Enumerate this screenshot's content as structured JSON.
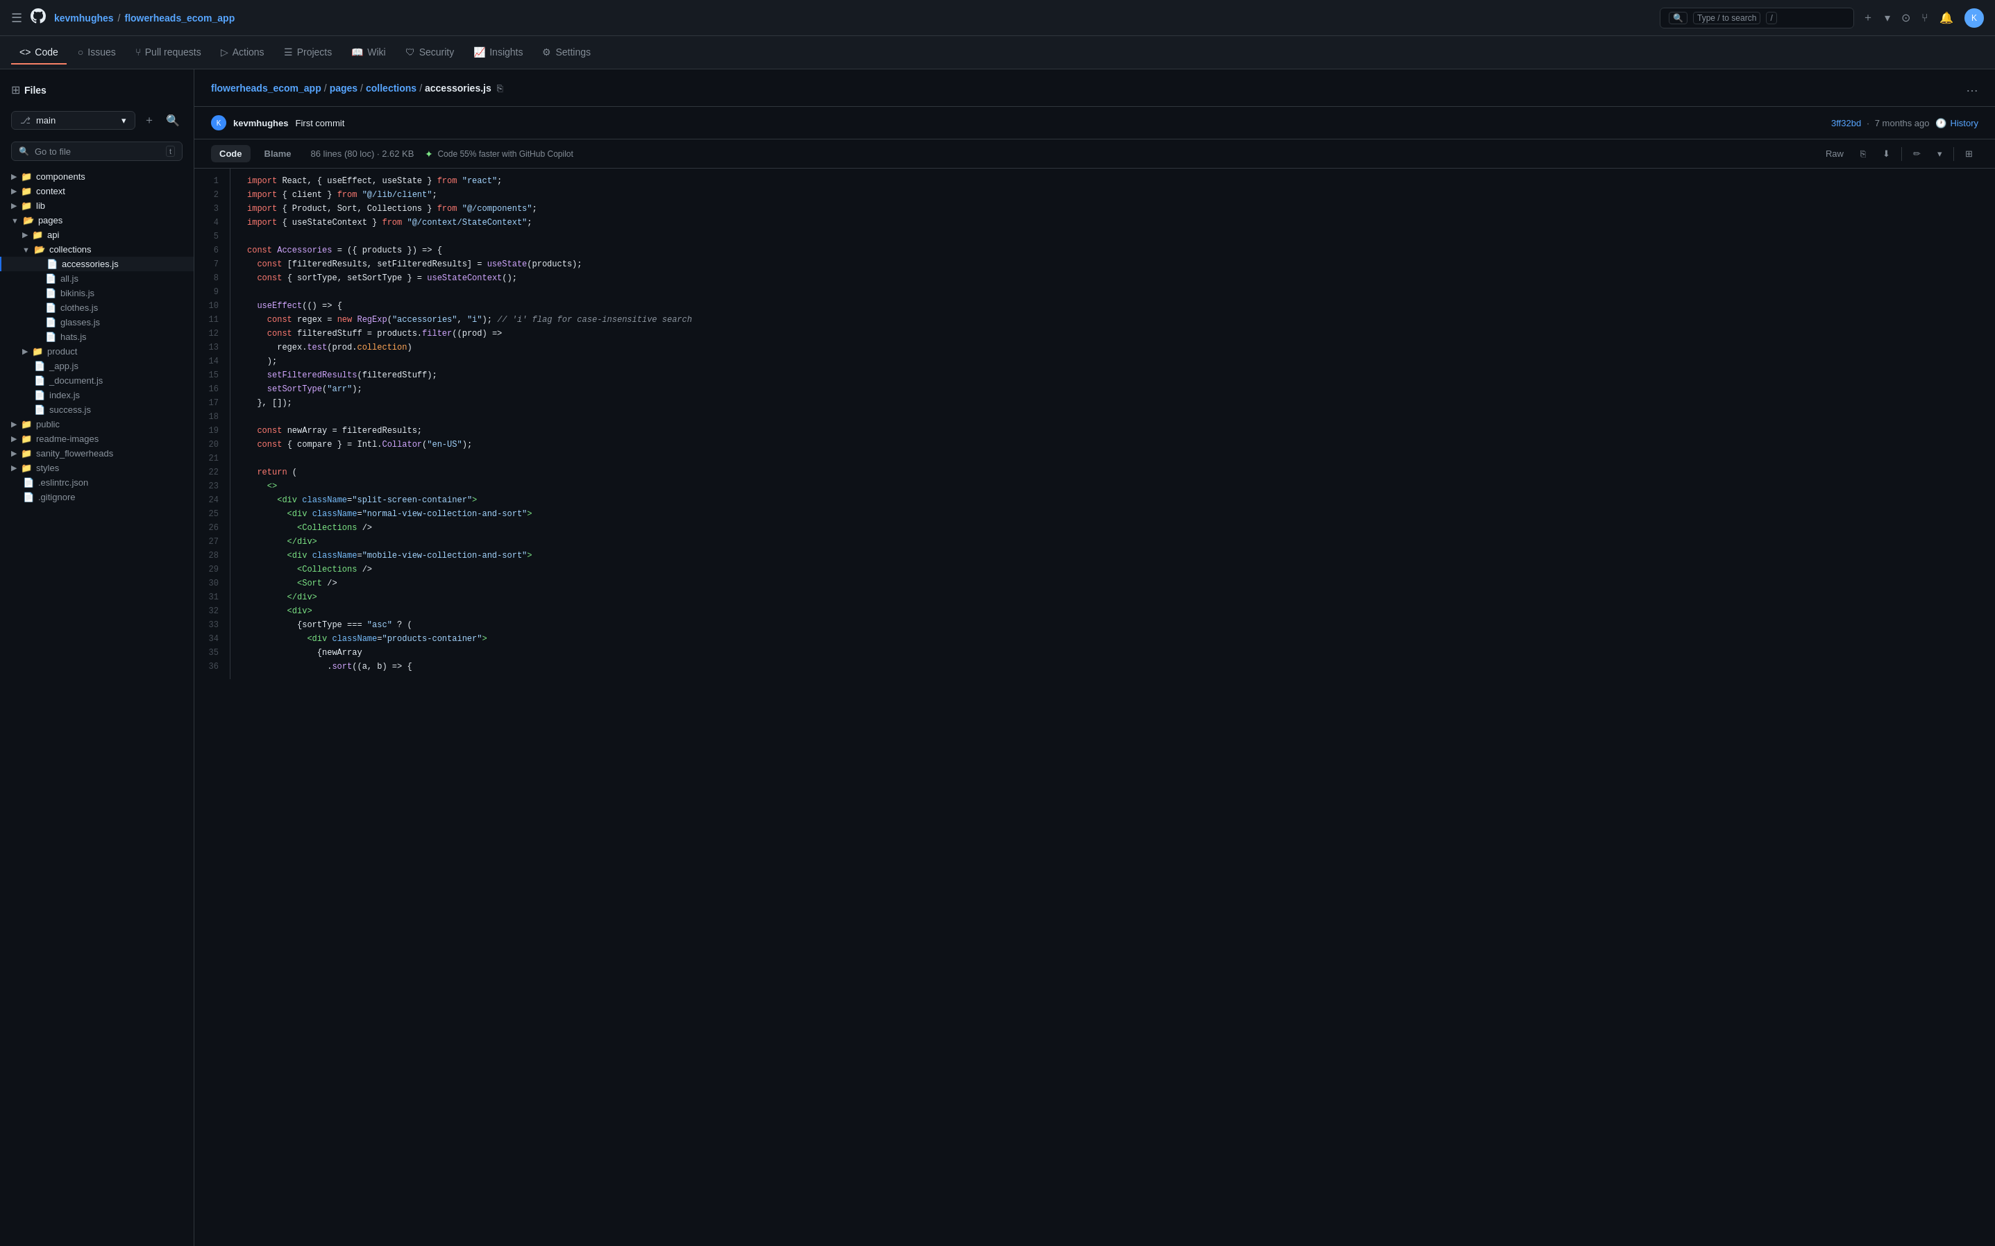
{
  "topNav": {
    "username": "kevmhughes",
    "separator": "/",
    "repo": "flowerheads_ecom_app",
    "search_placeholder": "Type / to search",
    "plus_icon": "+",
    "avatar_initials": "K"
  },
  "repoNav": {
    "items": [
      {
        "id": "code",
        "label": "Code",
        "icon": "<>",
        "active": true
      },
      {
        "id": "issues",
        "label": "Issues",
        "icon": "○"
      },
      {
        "id": "pull-requests",
        "label": "Pull requests",
        "icon": "⑂"
      },
      {
        "id": "actions",
        "label": "Actions",
        "icon": "▷"
      },
      {
        "id": "projects",
        "label": "Projects",
        "icon": "☰"
      },
      {
        "id": "wiki",
        "label": "Wiki",
        "icon": "📖"
      },
      {
        "id": "security",
        "label": "Security",
        "icon": "🛡"
      },
      {
        "id": "insights",
        "label": "Insights",
        "icon": "📈"
      },
      {
        "id": "settings",
        "label": "Settings",
        "icon": "⚙"
      }
    ]
  },
  "sidebar": {
    "files_label": "Files",
    "branch": "main",
    "go_to_file": "Go to file",
    "go_to_file_shortcut": "t",
    "tree": [
      {
        "id": "components",
        "type": "folder",
        "label": "components",
        "indent": 0,
        "collapsed": true
      },
      {
        "id": "context",
        "type": "folder",
        "label": "context",
        "indent": 0,
        "collapsed": true
      },
      {
        "id": "lib",
        "type": "folder",
        "label": "lib",
        "indent": 0,
        "collapsed": true
      },
      {
        "id": "pages",
        "type": "folder",
        "label": "pages",
        "indent": 0,
        "collapsed": false
      },
      {
        "id": "api",
        "type": "folder",
        "label": "api",
        "indent": 1,
        "collapsed": true
      },
      {
        "id": "collections",
        "type": "folder",
        "label": "collections",
        "indent": 1,
        "collapsed": false
      },
      {
        "id": "accessories-js",
        "type": "file",
        "label": "accessories.js",
        "indent": 2,
        "active": true
      },
      {
        "id": "all-js",
        "type": "file",
        "label": "all.js",
        "indent": 2
      },
      {
        "id": "bikinis-js",
        "type": "file",
        "label": "bikinis.js",
        "indent": 2
      },
      {
        "id": "clothes-js",
        "type": "file",
        "label": "clothes.js",
        "indent": 2
      },
      {
        "id": "glasses-js",
        "type": "file",
        "label": "glasses.js",
        "indent": 2
      },
      {
        "id": "hats-js",
        "type": "file",
        "label": "hats.js",
        "indent": 2
      },
      {
        "id": "product",
        "type": "folder",
        "label": "product",
        "indent": 1,
        "collapsed": true
      },
      {
        "id": "_app-js",
        "type": "file",
        "label": "_app.js",
        "indent": 1
      },
      {
        "id": "_document-js",
        "type": "file",
        "label": "_document.js",
        "indent": 1
      },
      {
        "id": "index-js",
        "type": "file",
        "label": "index.js",
        "indent": 1
      },
      {
        "id": "success-js",
        "type": "file",
        "label": "success.js",
        "indent": 1
      },
      {
        "id": "public",
        "type": "folder",
        "label": "public",
        "indent": 0,
        "collapsed": true
      },
      {
        "id": "readme-images",
        "type": "folder",
        "label": "readme-images",
        "indent": 0,
        "collapsed": true
      },
      {
        "id": "sanity-flowerheads",
        "type": "folder",
        "label": "sanity_flowerheads",
        "indent": 0,
        "collapsed": true
      },
      {
        "id": "styles",
        "type": "folder",
        "label": "styles",
        "indent": 0,
        "collapsed": true
      },
      {
        "id": "eslintrc-json",
        "type": "file",
        "label": ".eslintrc.json",
        "indent": 0
      },
      {
        "id": "gitignore",
        "type": "file",
        "label": ".gitignore",
        "indent": 0
      }
    ]
  },
  "breadcrumb": {
    "parts": [
      {
        "label": "flowerheads_ecom_app",
        "link": true
      },
      {
        "label": "pages",
        "link": true
      },
      {
        "label": "collections",
        "link": true
      },
      {
        "label": "accessories.js",
        "link": false
      }
    ]
  },
  "fileMeta": {
    "author_initials": "K",
    "author": "kevmhughes",
    "message": "First commit",
    "hash": "3ff32bd",
    "age": "7 months ago",
    "history_label": "History"
  },
  "fileActions": {
    "code_label": "Code",
    "blame_label": "Blame",
    "lines": "86 lines (80 loc)",
    "size": "2.62 KB",
    "copilot": "Code 55% faster with GitHub Copilot",
    "raw": "Raw"
  },
  "codeLines": [
    {
      "n": 1,
      "html": "<span class='import-kw'>import</span> <span class='plain'>React, { useEffect, useState } </span><span class='import-kw'>from</span> <span class='str'>\"react\"</span><span class='plain'>;</span>"
    },
    {
      "n": 2,
      "html": "<span class='import-kw'>import</span> <span class='plain'>{ client } </span><span class='import-kw'>from</span> <span class='str'>\"@/lib/client\"</span><span class='plain'>;</span>"
    },
    {
      "n": 3,
      "html": "<span class='import-kw'>import</span> <span class='plain'>{ Product, Sort, Collections } </span><span class='import-kw'>from</span> <span class='str'>\"@/components\"</span><span class='plain'>;</span>"
    },
    {
      "n": 4,
      "html": "<span class='import-kw'>import</span> <span class='plain'>{ useStateContext } </span><span class='import-kw'>from</span> <span class='str'>\"@/context/StateContext\"</span><span class='plain'>;</span>"
    },
    {
      "n": 5,
      "html": ""
    },
    {
      "n": 6,
      "html": "<span class='kw'>const</span> <span class='fn'>Accessories</span> <span class='plain'>= ({ products }) =&gt; {</span>",
      "expand": true
    },
    {
      "n": 7,
      "html": "<span class='plain'>  </span><span class='kw'>const</span> <span class='plain'>[filteredResults, setFilteredResults] = </span><span class='fn'>useState</span><span class='plain'>(products);</span>"
    },
    {
      "n": 8,
      "html": "<span class='plain'>  </span><span class='kw'>const</span> <span class='plain'>{ sortType, setSortType } = </span><span class='fn'>useStateContext</span><span class='plain'>();</span>"
    },
    {
      "n": 9,
      "html": ""
    },
    {
      "n": 10,
      "html": "<span class='plain'>  </span><span class='fn'>useEffect</span><span class='plain'>(() =&gt; {</span>"
    },
    {
      "n": 11,
      "html": "<span class='plain'>    </span><span class='kw'>const</span> <span class='plain'>regex = </span><span class='kw'>new</span> <span class='fn'>RegExp</span><span class='plain'>(</span><span class='str'>\"accessories\"</span><span class='plain'>, </span><span class='str'>\"i\"</span><span class='plain'>); </span><span class='cm'>// 'i' flag for case-insensitive search</span>"
    },
    {
      "n": 12,
      "html": "<span class='plain'>    </span><span class='kw'>const</span> <span class='plain'>filteredStuff = products.</span><span class='fn'>filter</span><span class='plain'>((prod) =&gt;</span>"
    },
    {
      "n": 13,
      "html": "<span class='plain'>      regex.</span><span class='fn'>test</span><span class='plain'>(prod.</span><span class='var'>collection</span><span class='plain'>)</span>"
    },
    {
      "n": 14,
      "html": "<span class='plain'>    );</span>"
    },
    {
      "n": 15,
      "html": "<span class='plain'>    </span><span class='fn'>setFilteredResults</span><span class='plain'>(filteredStuff);</span>"
    },
    {
      "n": 16,
      "html": "<span class='plain'>    </span><span class='fn'>setSortType</span><span class='plain'>(</span><span class='str'>\"arr\"</span><span class='plain'>);</span>"
    },
    {
      "n": 17,
      "html": "<span class='plain'>  }, []);</span>"
    },
    {
      "n": 18,
      "html": ""
    },
    {
      "n": 19,
      "html": "<span class='plain'>  </span><span class='kw'>const</span> <span class='plain'>newArray = filteredResults;</span>"
    },
    {
      "n": 20,
      "html": "<span class='plain'>  </span><span class='kw'>const</span> <span class='plain'>{ compare } = Intl.</span><span class='fn'>Collator</span><span class='plain'>(</span><span class='str'>\"en-US\"</span><span class='plain'>);</span>"
    },
    {
      "n": 21,
      "html": ""
    },
    {
      "n": 22,
      "html": "<span class='plain'>  </span><span class='kw'>return</span> <span class='plain'>(</span>"
    },
    {
      "n": 23,
      "html": "<span class='plain'>    </span><span class='tag'>&lt;&gt;</span>"
    },
    {
      "n": 24,
      "html": "<span class='plain'>      </span><span class='tag'>&lt;div</span> <span class='attr'>className</span><span class='plain'>=</span><span class='str'>\"split-screen-container\"</span><span class='tag'>&gt;</span>"
    },
    {
      "n": 25,
      "html": "<span class='plain'>        </span><span class='tag'>&lt;div</span> <span class='attr'>className</span><span class='plain'>=</span><span class='str'>\"normal-view-collection-and-sort\"</span><span class='tag'>&gt;</span>"
    },
    {
      "n": 26,
      "html": "<span class='plain'>          </span><span class='tag'>&lt;Collections</span> <span class='plain'>/&gt;</span>"
    },
    {
      "n": 27,
      "html": "<span class='plain'>        </span><span class='tag'>&lt;/div&gt;</span>"
    },
    {
      "n": 28,
      "html": "<span class='plain'>        </span><span class='tag'>&lt;div</span> <span class='attr'>className</span><span class='plain'>=</span><span class='str'>\"mobile-view-collection-and-sort\"</span><span class='tag'>&gt;</span>"
    },
    {
      "n": 29,
      "html": "<span class='plain'>          </span><span class='tag'>&lt;Collections</span> <span class='plain'>/&gt;</span>"
    },
    {
      "n": 30,
      "html": "<span class='plain'>          </span><span class='tag'>&lt;Sort</span> <span class='plain'>/&gt;</span>"
    },
    {
      "n": 31,
      "html": "<span class='plain'>        </span><span class='tag'>&lt;/div&gt;</span>"
    },
    {
      "n": 32,
      "html": "<span class='plain'>        </span><span class='tag'>&lt;div&gt;</span>"
    },
    {
      "n": 33,
      "html": "<span class='plain'>          {sortType === </span><span class='str'>\"asc\"</span> <span class='plain'>? (</span>"
    },
    {
      "n": 34,
      "html": "<span class='plain'>            </span><span class='tag'>&lt;div</span> <span class='attr'>className</span><span class='plain'>=</span><span class='str'>\"products-container\"</span><span class='tag'>&gt;</span>"
    },
    {
      "n": 35,
      "html": "<span class='plain'>              {newArray</span>"
    },
    {
      "n": 36,
      "html": "<span class='plain'>                .</span><span class='fn'>sort</span><span class='plain'>((a, b) =&gt; {</span>"
    }
  ],
  "colors": {
    "bg": "#0d1117",
    "surface": "#161b22",
    "border": "#30363d",
    "accent": "#58a6ff",
    "text_primary": "#e6edf3",
    "text_secondary": "#848d97",
    "active_tab_border": "#f78166"
  }
}
